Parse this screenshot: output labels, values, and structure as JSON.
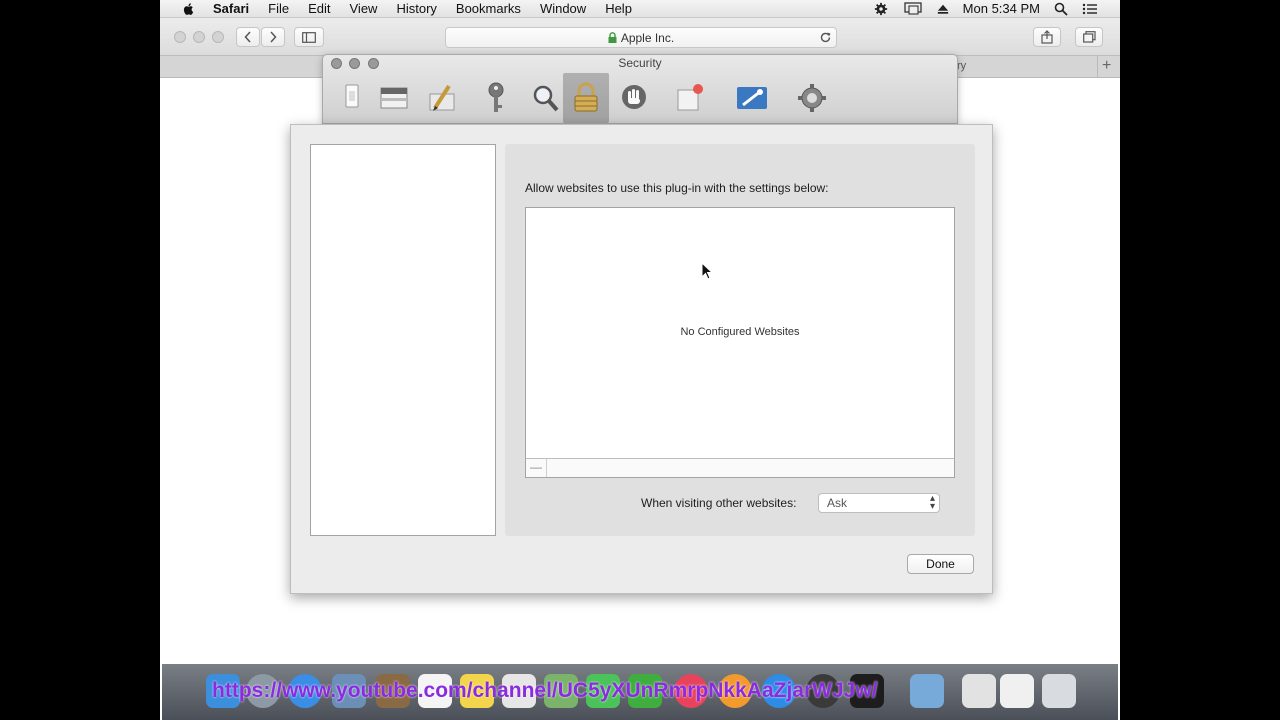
{
  "menubar": {
    "app_name": "Safari",
    "items": [
      "File",
      "Edit",
      "View",
      "History",
      "Bookmarks",
      "Window",
      "Help"
    ],
    "clock": "Mon 5:34 PM"
  },
  "toolbar": {
    "address": "Apple Inc."
  },
  "tabstrip": {
    "visible_tab_fragment": "ry"
  },
  "prefs": {
    "title": "Security",
    "toolbar_icons": [
      "general-icon",
      "tabs-icon",
      "autofill-icon",
      "passwords-icon",
      "search-icon",
      "security-icon",
      "privacy-icon",
      "notifications-icon",
      "extensions-icon",
      "advanced-icon"
    ],
    "active_icon": "security-icon"
  },
  "sheet": {
    "allow_text": "Allow websites to use this plug-in with the settings below:",
    "empty_table_text": "No Configured Websites",
    "minus_label": "—",
    "visiting_label": "When visiting other websites:",
    "visiting_value": "Ask",
    "done_label": "Done"
  },
  "overlay": {
    "url_text": "https://www.youtube.com/channel/UC5yXUnRmrpNkkAaZjarWJJw/"
  },
  "colors": {
    "overlay_text": "#8a2be2",
    "lock_green": "#3c9a3c"
  }
}
